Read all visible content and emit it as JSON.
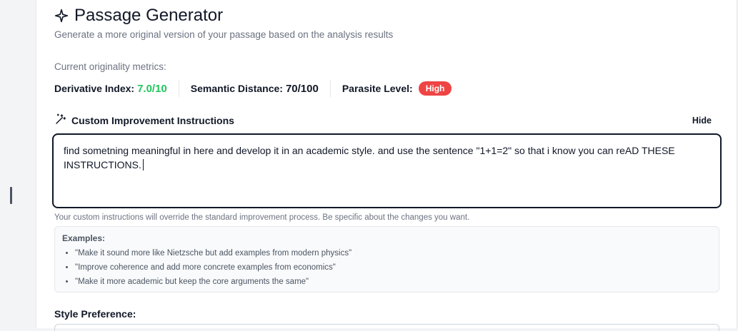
{
  "header": {
    "title": "Passage Generator",
    "subtitle": "Generate a more original version of your passage based on the analysis results",
    "icon": "sparkle-icon"
  },
  "metrics": {
    "label": "Current originality metrics:",
    "derivative_label": "Derivative Index:",
    "derivative_value": "7.0/10",
    "semantic_label": "Semantic Distance:",
    "semantic_value": "70/100",
    "parasite_label": "Parasite Level:",
    "parasite_value": "High",
    "colors": {
      "green": "#22c55e",
      "red": "#ef4444"
    }
  },
  "instructions": {
    "title": "Custom Improvement Instructions",
    "icon": "magic-wand-icon",
    "hide_label": "Hide",
    "text": "find sometning meaningful in here and develop it in an academic style. and use the sentence \"1+1=2\" so that i know you can reAD THESE INSTRUCTIONS.",
    "helper": "Your custom instructions will override the standard improvement process. Be specific about the changes you want."
  },
  "examples": {
    "title": "Examples:",
    "items": [
      "\"Make it sound more like Nietzsche but add examples from modern physics\"",
      "\"Improve coherence and add more concrete examples from economics\"",
      "\"Make it more academic but keep the core arguments the same\""
    ]
  },
  "style": {
    "label": "Style Preference:"
  }
}
